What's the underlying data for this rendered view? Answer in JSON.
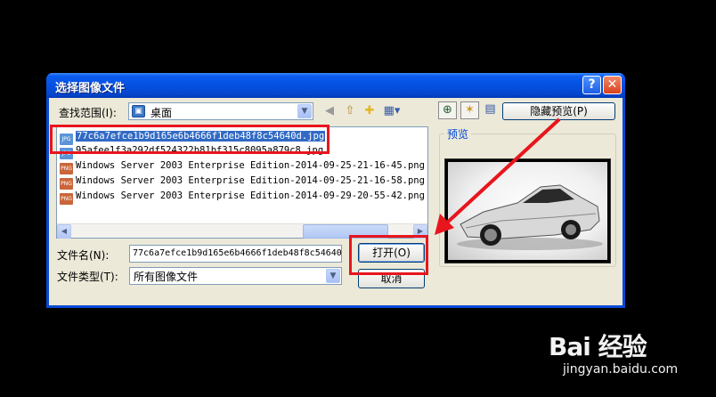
{
  "dialog": {
    "title": "选择图像文件",
    "help_symbol": "?",
    "close_symbol": "✕",
    "lookin_label": "查找范围(I):",
    "lookin_value": "桌面",
    "hide_preview_label": "隐藏预览(P)",
    "files": [
      {
        "name": "77c6a7efce1b9d165e6b4666f1deb48f8c54640d.jpg",
        "type": "JPG",
        "selected": true
      },
      {
        "name": "95afee1f3a292df524322b81bf315c8095a879c8.jpg",
        "type": "JPG",
        "selected": false
      },
      {
        "name": "Windows Server 2003 Enterprise Edition-2014-09-25-21-16-45.png",
        "type": "PNG",
        "selected": false
      },
      {
        "name": "Windows Server 2003 Enterprise Edition-2014-09-25-21-16-58.png",
        "type": "PNG",
        "selected": false
      },
      {
        "name": "Windows Server 2003 Enterprise Edition-2014-09-29-20-55-42.png",
        "type": "PNG",
        "selected": false
      }
    ],
    "filename_label": "文件名(N):",
    "filename_value": "77c6a7efce1b9d165e6b4666f1deb48f8c54640",
    "filetype_label": "文件类型(T):",
    "filetype_value": "所有图像文件",
    "open_label": "打开(O)",
    "cancel_label": "取消",
    "preview_label": "预览"
  },
  "watermark": {
    "logo": "Bai 经验",
    "url": "jingyan.baidu.com"
  },
  "colors": {
    "titlebar": "#0551e0",
    "dialog_bg": "#ece9d8",
    "selection": "#316ac5",
    "annotation_red": "#e8151d"
  }
}
